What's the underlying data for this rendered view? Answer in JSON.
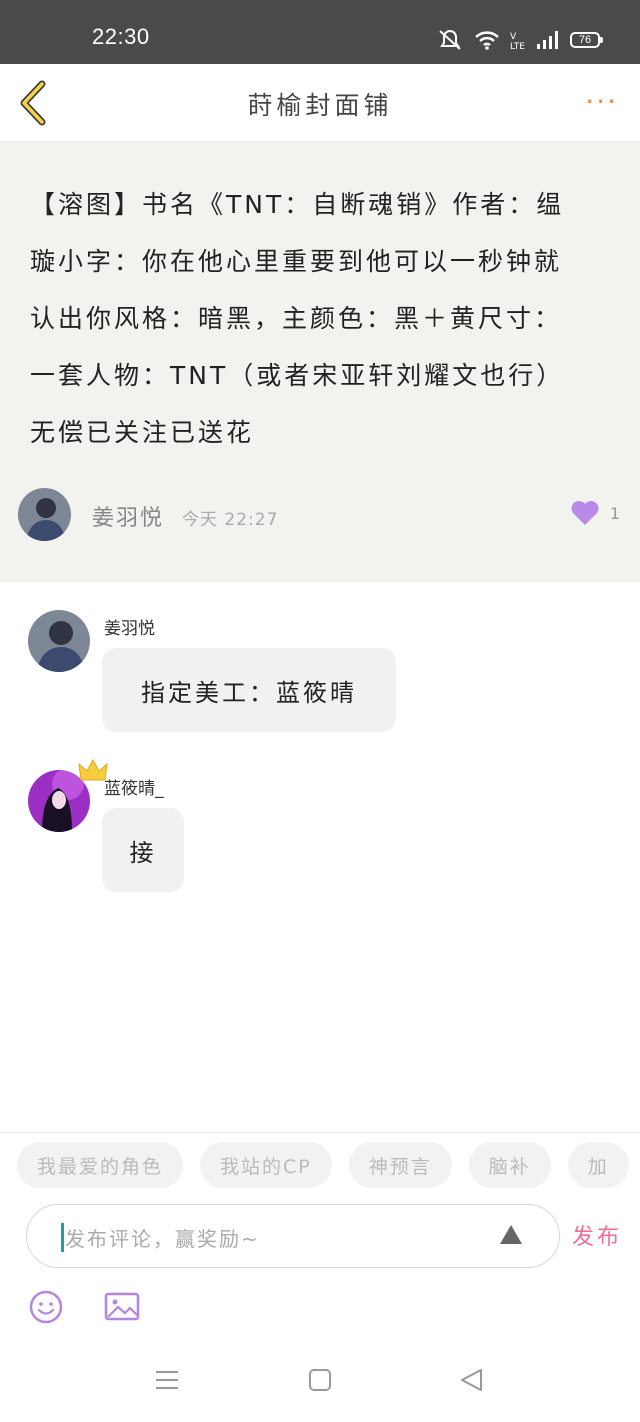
{
  "status_bar": {
    "time": "22:30",
    "battery": "76"
  },
  "header": {
    "title": "莳榆封面铺",
    "more_label": "···"
  },
  "post": {
    "lines": [
      "【溶图】书名《TNT：自断魂销》作者：缊",
      "璇小字：你在他心里重要到他可以一秒钟就",
      "认出你风格：暗黑，主颜色：黑＋黄尺寸：",
      "一套人物：TNT（或者宋亚轩刘耀文也行）",
      "无偿已关注已送花"
    ],
    "author": "姜羽悦",
    "time": "今天 22:27",
    "likes": "1",
    "like_color": "#b98be8"
  },
  "comments": [
    {
      "name": "姜羽悦",
      "text": "指定美工：蓝筱晴"
    },
    {
      "name": "蓝筱晴_",
      "text": "接"
    }
  ],
  "tags": [
    "我最爱的角色",
    "我站的CP",
    "神预言",
    "脑补",
    "加"
  ],
  "composer": {
    "placeholder": "发布评论，赢奖励~",
    "publish_label": "发布",
    "accent": "#ef6e9a"
  },
  "icons": {
    "back": "chevron-left-icon",
    "emoji": "smiley-icon",
    "image": "image-icon",
    "send": "triangle-up-icon"
  }
}
